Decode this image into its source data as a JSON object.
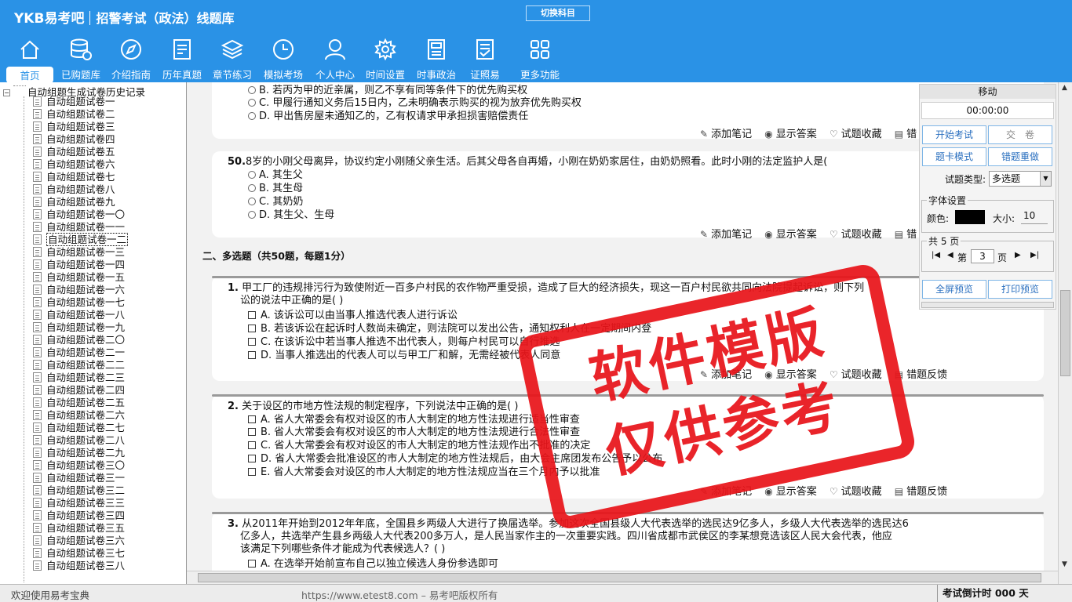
{
  "header": {
    "brand": "YKB易考吧",
    "subtitle": "招警考试（政法）线题库",
    "switch_label": "切换科目"
  },
  "nav": [
    {
      "label": "首页",
      "icon": "home-icon",
      "active": true
    },
    {
      "label": "已购题库",
      "icon": "database-icon"
    },
    {
      "label": "介绍指南",
      "icon": "compass-icon"
    },
    {
      "label": "历年真题",
      "icon": "document-list-icon"
    },
    {
      "label": "章节练习",
      "icon": "layers-icon"
    },
    {
      "label": "模拟考场",
      "icon": "clock-icon"
    },
    {
      "label": "个人中心",
      "icon": "user-icon"
    },
    {
      "label": "时间设置",
      "icon": "gear-icon"
    },
    {
      "label": "时事政治",
      "icon": "newspaper-icon"
    },
    {
      "label": "证照易",
      "icon": "certificate-icon"
    },
    {
      "label": "更多功能",
      "icon": "grid-icon"
    }
  ],
  "tree": {
    "root": "自动组题生成试卷历史记录",
    "items": [
      "自动组题试卷一",
      "自动组题试卷二",
      "自动组题试卷三",
      "自动组题试卷四",
      "自动组题试卷五",
      "自动组题试卷六",
      "自动组题试卷七",
      "自动组题试卷八",
      "自动组题试卷九",
      "自动组题试卷一〇",
      "自动组题试卷一一",
      "自动组题试卷一二",
      "自动组题试卷一三",
      "自动组题试卷一四",
      "自动组题试卷一五",
      "自动组题试卷一六",
      "自动组题试卷一七",
      "自动组题试卷一八",
      "自动组题试卷一九",
      "自动组题试卷二〇",
      "自动组题试卷二一",
      "自动组题试卷二二",
      "自动组题试卷二三",
      "自动组题试卷二四",
      "自动组题试卷二五",
      "自动组题试卷二六",
      "自动组题试卷二七",
      "自动组题试卷二八",
      "自动组题试卷二九",
      "自动组题试卷三〇",
      "自动组题试卷三一",
      "自动组题试卷三二",
      "自动组题试卷三三",
      "自动组题试卷三四",
      "自动组题试卷三五",
      "自动组题试卷三六",
      "自动组题试卷三七",
      "自动组题试卷三八"
    ],
    "selected_index": 11
  },
  "actions": {
    "note": "添加笔记",
    "answer": "显示答案",
    "fav": "试题收藏",
    "feedback": "错题反馈",
    "feedback_short": "错"
  },
  "q49": {
    "opt_b": "B. 若丙为甲的近亲属，则乙不享有同等条件下的优先购买权",
    "opt_c": "C. 甲履行通知义务后15日内，乙未明确表示购买的视为放弃优先购买权",
    "opt_d": "D. 甲出售房屋未通知乙的，乙有权请求甲承担损害赔偿责任"
  },
  "q50": {
    "num": "50.",
    "text": "8岁的小刚父母离异，协议约定小刚随父亲生活。后其父母各自再婚，小刚在奶奶家居住，由奶奶照看。此时小刚的法定监护人是(",
    "options": [
      "A. 其生父",
      "B. 其生母",
      "C. 其奶奶",
      "D. 其生父、生母"
    ]
  },
  "section": "二、多选题（共50题，每题1分）",
  "m1": {
    "num": "1.",
    "line1": "甲工厂的违规排污行为致使附近一百多户村民的农作物严重受损，造成了巨大的经济损失，现这一百户村民欲共同向法院提起诉讼，则下列",
    "line2": "讼的说法中正确的是(  )",
    "options": [
      "A. 该诉讼可以由当事人推选代表人进行诉讼",
      "B. 若该诉讼在起诉时人数尚未确定，则法院可以发出公告，通知权利人在一定期间内登",
      "C. 在该诉讼中若当事人推选不出代表人，则每户村民可以自行推选",
      "D. 当事人推选出的代表人可以与甲工厂和解，无需经被代表人同意"
    ]
  },
  "m2": {
    "num": "2.",
    "text": "关于设区的市地方性法规的制定程序，下列说法中正确的是(  )",
    "options": [
      "A. 省人大常委会有权对设区的市人大制定的地方性法规进行适当性审查",
      "B. 省人大常委会有权对设区的市人大制定的地方性法规进行合法性审查",
      "C. 省人大常委会有权对设区的市人大制定的地方性法规作出不批准的决定",
      "D. 省人大常委会批准设区的市人大制定的地方性法规后，由大会主席团发布公告予以公布",
      "E. 省人大常委会对设区的市人大制定的地方性法规应当在三个月内予以批准"
    ]
  },
  "m3": {
    "num": "3.",
    "line1": "从2011年开始到2012年年底，全国县乡两级人大进行了换届选举。参加这次全国县级人大代表选举的选民达9亿多人，乡级人大代表选举的选民达6",
    "line2": "亿多人，共选举产生县乡两级人大代表200多万人，是人民当家作主的一次重要实践。四川省成都市武侯区的李某想竞选该区人民大会代表，他应",
    "line3": "该满足下列哪些条件才能成为代表候选人？(  )",
    "option_a": "A. 在选举开始前宣布自己以独立候选人身份参选即可"
  },
  "panel": {
    "title": "移动",
    "time": "00:00:00",
    "start": "开始考试",
    "submit": "交　卷",
    "card_mode": "题卡模式",
    "redo": "错题重做",
    "type_label": "试题类型:",
    "type_value": "多选题",
    "font_group": "字体设置",
    "color_label": "颜色:",
    "size_label": "大小:",
    "size_value": "10",
    "pages_group": "共 5 页",
    "page_prefix": "第",
    "page_value": "3",
    "page_suffix": "页",
    "fullscreen": "全屏预览",
    "print": "打印预览"
  },
  "status": {
    "welcome": "欢迎使用易考宝典",
    "copyright": "https://www.etest8.com – 易考吧版权所有",
    "countdown": "考试倒计时 000 天"
  },
  "watermark": {
    "line1": "软件模版",
    "line2": "仅供参考"
  },
  "colors": {
    "header": "#2a92e6",
    "accent": "#e8141a"
  }
}
